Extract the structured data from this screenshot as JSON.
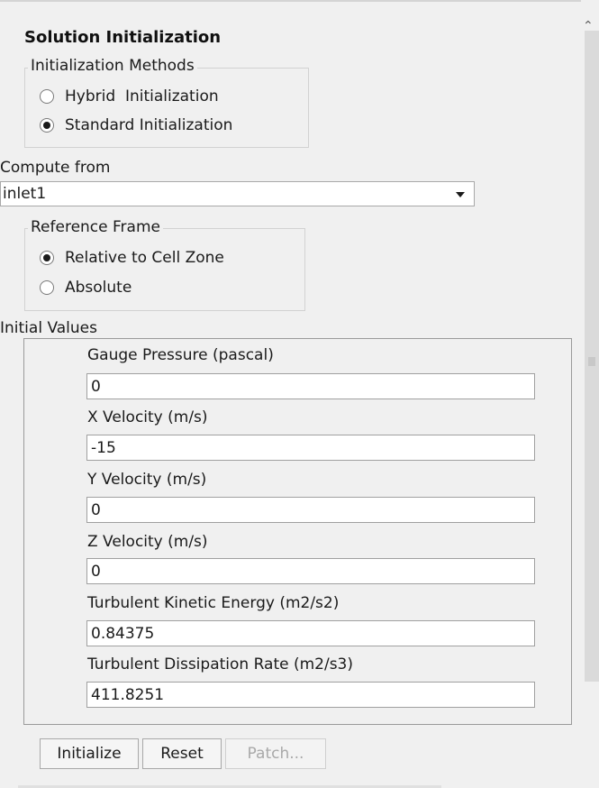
{
  "panel": {
    "title": "Solution Initialization"
  },
  "initialization_methods": {
    "legend": "Initialization Methods",
    "options": [
      {
        "label": "Hybrid  Initialization",
        "selected": false
      },
      {
        "label": "Standard Initialization",
        "selected": true
      }
    ]
  },
  "compute_from": {
    "label": "Compute from",
    "selected": "inlet1"
  },
  "reference_frame": {
    "legend": "Reference Frame",
    "options": [
      {
        "label": "Relative to Cell Zone",
        "selected": true
      },
      {
        "label": "Absolute",
        "selected": false
      }
    ]
  },
  "initial_values": {
    "legend": "Initial Values",
    "fields": [
      {
        "label": "Gauge Pressure (pascal)",
        "value": "0"
      },
      {
        "label": "X Velocity (m/s)",
        "value": "-15"
      },
      {
        "label": "Y Velocity (m/s)",
        "value": "0"
      },
      {
        "label": "Z Velocity (m/s)",
        "value": "0"
      },
      {
        "label": "Turbulent Kinetic Energy (m2/s2)",
        "value": "0.84375"
      },
      {
        "label": "Turbulent Dissipation Rate (m2/s3)",
        "value": "411.8251"
      }
    ]
  },
  "buttons": {
    "initialize": "Initialize",
    "reset": "Reset",
    "patch": "Patch..."
  }
}
